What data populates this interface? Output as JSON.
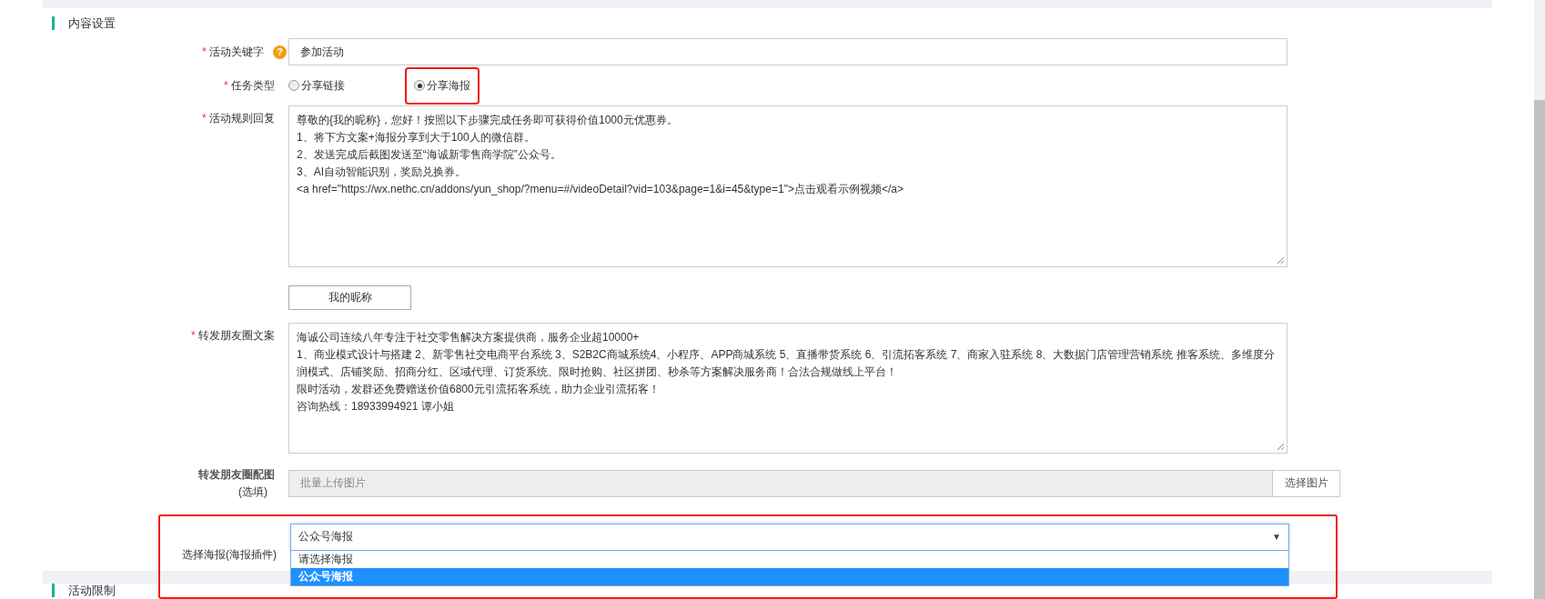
{
  "section": {
    "title": "内容设置"
  },
  "keyword": {
    "label": "活动关键字",
    "required": "*",
    "help": "?",
    "value": "参加活动"
  },
  "task_type": {
    "label": "任务类型",
    "required": "*",
    "options": [
      {
        "label": "分享链接",
        "selected": false,
        "highlighted": false
      },
      {
        "label": "分享海报",
        "selected": true,
        "highlighted": true
      }
    ]
  },
  "rule_reply": {
    "label": "活动规则回复",
    "required": "*",
    "lines": [
      "尊敬的{我的昵称}，您好！按照以下步骤完成任务即可获得价值1000元优惠券。",
      "1、将下方文案+海报分享到大于100人的微信群。",
      "2、发送完成后截图发送至“海诚新零售商学院”公众号。",
      "3、AI自动智能识别，奖励兑换券。",
      "<a href=\"https://wx.nethc.cn/addons/yun_shop/?menu=#/videoDetail?vid=103&page=1&i=45&type=1\">点击观看示例视频</a>"
    ]
  },
  "nickname_button": "我的昵称",
  "moments_text": {
    "label": "转发朋友圈文案",
    "required": "*",
    "lines": [
      "海诚公司连续八年专注于社交零售解决方案提供商，服务企业超10000+",
      "1、商业模式设计与搭建 2、新零售社交电商平台系统 3、S2B2C商城系统4、小程序、APP商城系统 5、直播带货系统 6、引流拓客系统 7、商家入驻系统 8、大数据门店管理营销系统 推客系统、多维度分润模式、店铺奖励、招商分红、区域代理、订货系统、限时抢购、社区拼团、秒杀等方案解决服务商！合法合规做线上平台！",
      "限时活动，发群还免费赠送价值6800元引流拓客系统，助力企业引流拓客！",
      "咨询热线：18933994921  谭小姐"
    ]
  },
  "moments_image": {
    "label": "转发朋友圈配图",
    "note": "(选填)",
    "placeholder": "批量上传图片",
    "button": "选择图片"
  },
  "poster_select": {
    "label": "选择海报(海报插件)",
    "value": "公众号海报",
    "arrow": "▼",
    "highlighted": true,
    "options": [
      {
        "label": "请选择海报",
        "selected": false
      },
      {
        "label": "公众号海报",
        "selected": true
      }
    ]
  },
  "next_section": {
    "title": "活动限制"
  }
}
